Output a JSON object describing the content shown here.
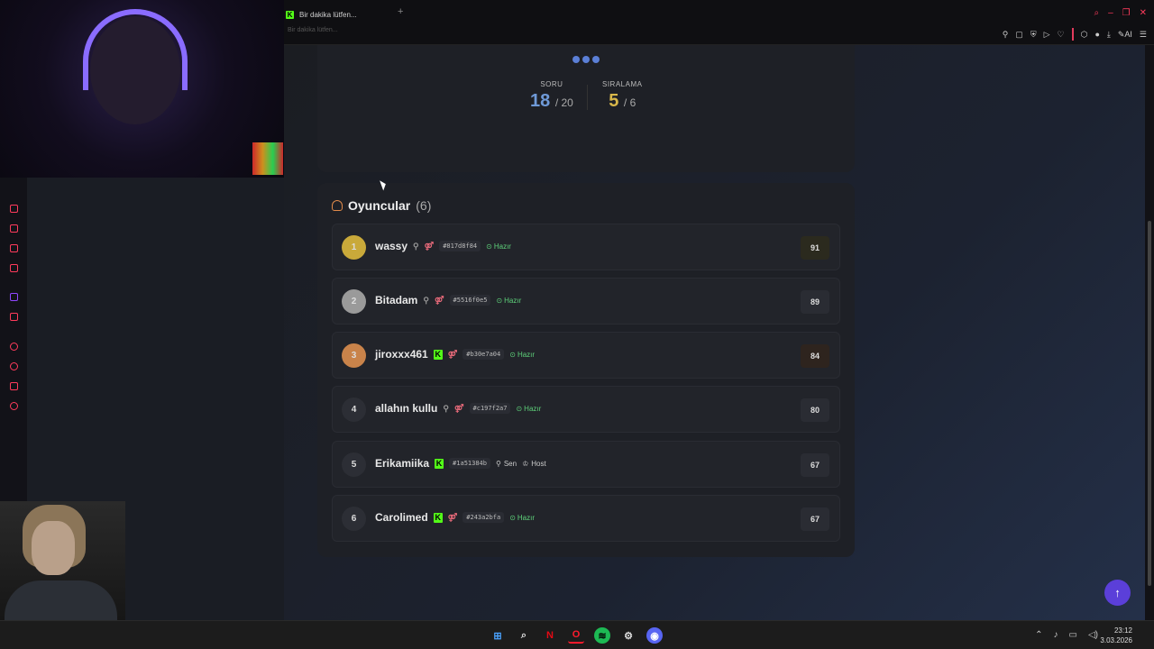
{
  "browser": {
    "tab_title": "Bir dakika lütfen...",
    "address_hint": "Bir dakika lütfen...",
    "toolbar_ai_label": "AI"
  },
  "quiz": {
    "question_label": "SORU",
    "question_current": "18",
    "question_total": "/ 20",
    "rank_label": "SIRALAMA",
    "rank_current": "5",
    "rank_total": "/ 6"
  },
  "players": {
    "title": "Oyuncular",
    "count": "(6)",
    "rows": [
      {
        "rank": "1",
        "name": "wassy",
        "hash": "#817d8f84",
        "status": "Hazır",
        "score": "91",
        "kick": false
      },
      {
        "rank": "2",
        "name": "Bitadam",
        "hash": "#5516f0e5",
        "status": "Hazır",
        "score": "89",
        "kick": false
      },
      {
        "rank": "3",
        "name": "jiroxxx461",
        "hash": "#b30e7a04",
        "status": "Hazır",
        "score": "84",
        "kick": true
      },
      {
        "rank": "4",
        "name": "allahın kullu",
        "hash": "#c197f2a7",
        "status": "Hazır",
        "score": "80",
        "kick": false
      },
      {
        "rank": "5",
        "name": "Erikamiika",
        "hash": "#1a51384b",
        "tag_you": "Sen",
        "tag_host": "Host",
        "score": "67",
        "kick": true
      },
      {
        "rank": "6",
        "name": "Carolimed",
        "hash": "#243a2bfa",
        "status": "Hazır",
        "score": "67",
        "kick": true
      }
    ]
  },
  "colors": {
    "question_accent": "#6f9ad8",
    "rank_accent": "#d8b74a",
    "gold": "#c9a93a",
    "silver": "#9a9a9a",
    "bronze": "#c9834a",
    "kick_green": "#53fc18"
  },
  "taskbar": {
    "time": "23:12",
    "date": "3.03.2026"
  }
}
